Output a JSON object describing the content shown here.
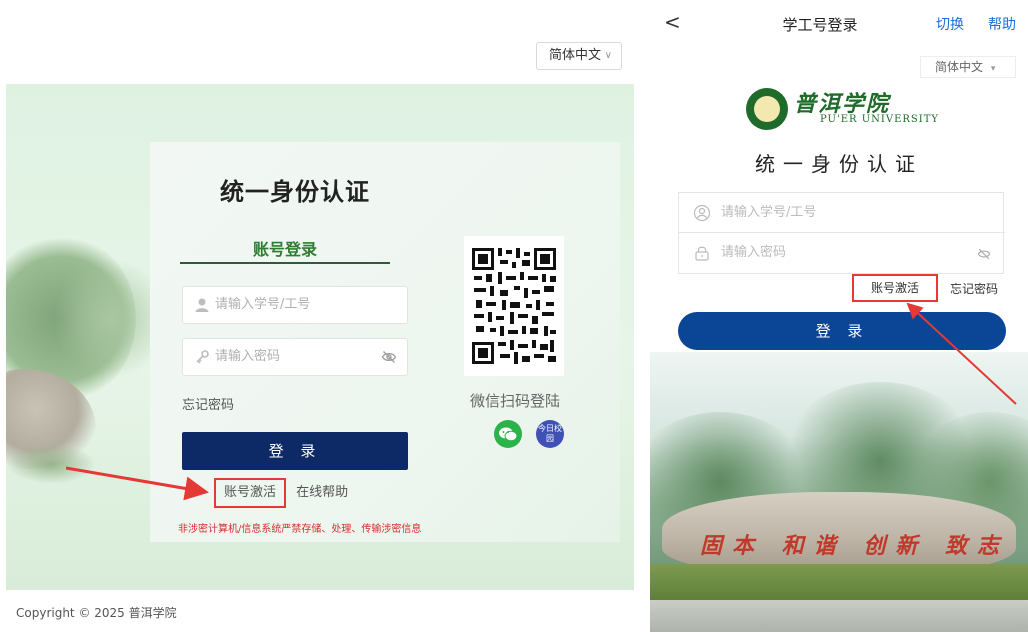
{
  "desktop": {
    "language": "简体中文",
    "title": "统一身份认证",
    "tab": "账号登录",
    "username_placeholder": "请输入学号/工号",
    "password_placeholder": "请输入密码",
    "forgot": "忘记密码",
    "login": "登 录",
    "activate": "账号激活",
    "help": "在线帮助",
    "warning": "非涉密计算机/信息系统严禁存储、处理、传输涉密信息",
    "scan_label": "微信扫码登陆",
    "jr_icon_text": "今日校园",
    "copyright": "Copyright © 2025 普洱学院"
  },
  "mobile": {
    "back": "<",
    "title": "学工号登录",
    "switch": "切换",
    "help": "帮助",
    "language": "简体中文",
    "logo_cn": "普洱学院",
    "logo_en": "PU'ER UNIVERSITY",
    "auth_title": "统一身份认证",
    "username_placeholder": "请输入学号/工号",
    "password_placeholder": "请输入密码",
    "activate": "账号激活",
    "forgot": "忘记密码",
    "login": "登 录",
    "stone_text": "固本 和谐 创新 致志"
  },
  "colors": {
    "accent_red": "#e53935",
    "navy_button": "#0e2a66",
    "mobile_button": "#0b4596",
    "link_blue": "#1e6fd9",
    "green_brand": "#1e6b2a"
  },
  "icons": [
    "user-icon",
    "key-icon",
    "eye-off-icon",
    "wechat-icon",
    "jinri-xiaoyuan-icon",
    "chevron-down-icon",
    "back-icon",
    "lock-icon"
  ]
}
